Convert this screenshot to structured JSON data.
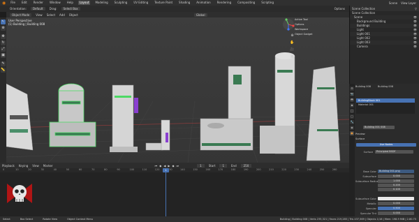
{
  "topbar": {
    "menus": [
      "File",
      "Edit",
      "Render",
      "Window",
      "Help"
    ],
    "tabs": [
      "Layout",
      "Modeling",
      "Sculpting",
      "UV Editing",
      "Texture Paint",
      "Shading",
      "Animation",
      "Rendering",
      "Compositing",
      "Scripting"
    ],
    "active_tab": "Layout",
    "scene": "Scene",
    "view_layer": "View Layer"
  },
  "toolrow": {
    "items": [
      "Orientation:",
      "Default",
      "Drag:",
      "Select Box"
    ],
    "right": [
      "Options"
    ]
  },
  "viewport_header": {
    "mode": "Object Mode",
    "menus": [
      "View",
      "Select",
      "Add",
      "Object"
    ],
    "transform": "Global"
  },
  "viewport": {
    "info_line1": "User Perspective",
    "info_line2": "(1) Building | Building 008",
    "overlay_menu": [
      "Active Tool",
      "Options",
      "Workspace",
      "Object Gadget"
    ]
  },
  "outliner": {
    "title": "Scene Collection",
    "rows": [
      {
        "label": "Scene Collection",
        "indent": 0
      },
      {
        "label": "Scene",
        "indent": 1
      },
      {
        "label": "Background Building",
        "indent": 2
      },
      {
        "label": "Buildings",
        "indent": 2
      },
      {
        "label": "Light",
        "indent": 2
      },
      {
        "label": "Light 001",
        "indent": 2
      },
      {
        "label": "Light 002",
        "indent": 2
      },
      {
        "label": "Light 003",
        "indent": 2
      },
      {
        "label": "Camera",
        "indent": 2
      }
    ]
  },
  "properties": {
    "object_name": "Building 008",
    "material_slot_1": "BuildingBlock 001",
    "material_slot_2": "Material 001",
    "material_name": "Building 001 008",
    "surface_label": "Surface",
    "preview_label": "Preview",
    "surface_value": "Principled BSDF",
    "fields": [
      {
        "label": "Base Color",
        "value": "Building 001.png"
      },
      {
        "label": "Subsurface",
        "value": "0.000"
      },
      {
        "label": "Subsurface Radius",
        "value": "1.000"
      },
      {
        "label": "",
        "value": "0.200"
      },
      {
        "label": "",
        "value": "0.100"
      },
      {
        "label": "Subsurface Color",
        "value": ""
      },
      {
        "label": "Metallic",
        "value": "0.000"
      },
      {
        "label": "Specular",
        "value": "0.500"
      },
      {
        "label": "Specular Tint",
        "value": "0.000"
      }
    ]
  },
  "timeline": {
    "menus": [
      "Playback",
      "Keying",
      "View",
      "Marker"
    ],
    "current_frame": "1",
    "start_label": "Start",
    "start": "1",
    "end_label": "End",
    "end": "250",
    "ticks": [
      "0",
      "10",
      "20",
      "30",
      "40",
      "50",
      "60",
      "70",
      "80",
      "90",
      "100",
      "110",
      "120",
      "130",
      "140",
      "150",
      "160",
      "170",
      "180",
      "190",
      "200",
      "210",
      "220",
      "230",
      "240",
      "250",
      "260"
    ]
  },
  "statusbar": {
    "left": [
      "Select",
      "Box Select",
      "Rotate View",
      "Object Context Menu"
    ],
    "right": "Building | Building 008 | Verts 235,321 | Faces 219,285 | Tris 437,569 | Objects 1/16 | Mem: 198.9 MiB | 2.80.75"
  },
  "colors": {
    "accent": "#4772b3",
    "brand_orange": "#e87d0d",
    "selection_green": "#4cd964"
  }
}
